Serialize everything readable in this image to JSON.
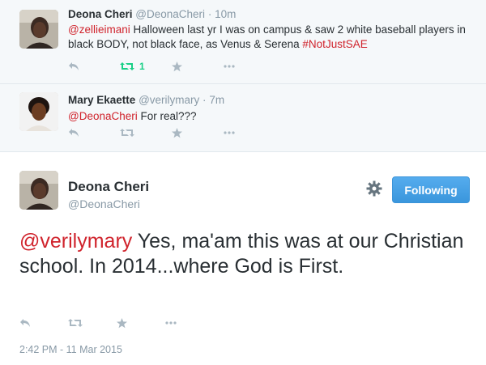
{
  "replies": [
    {
      "fullname": "Deona Cheri",
      "screenname": "@DeonaCheri",
      "separator": "·",
      "time": "10m",
      "text_parts": [
        "@zellieimani",
        " Halloween last yr I was on campus & saw 2 white baseball players in black BODY, not black face, as Venus & Serena ",
        "#NotJustSAE"
      ],
      "retweet_count": "1"
    },
    {
      "fullname": "Mary Ekaette",
      "screenname": "@verilymary",
      "separator": "·",
      "time": "7m",
      "text_parts": [
        "@DeonaCheri",
        " For real???"
      ]
    }
  ],
  "main": {
    "fullname": "Deona Cheri",
    "screenname": "@DeonaCheri",
    "follow_label": "Following",
    "text_parts": [
      "@verilymary",
      " Yes, ma'am this was at our Christian school. In 2014...where God is First."
    ],
    "timestamp": "2:42 PM - 11 Mar 2015"
  },
  "colors": {
    "link_red": "#d0232c",
    "retweet_green": "#19cf86",
    "follow_blue": "#55acee"
  },
  "icons": [
    "reply-icon",
    "retweet-icon",
    "favorite-icon",
    "more-icon",
    "gear-icon"
  ]
}
